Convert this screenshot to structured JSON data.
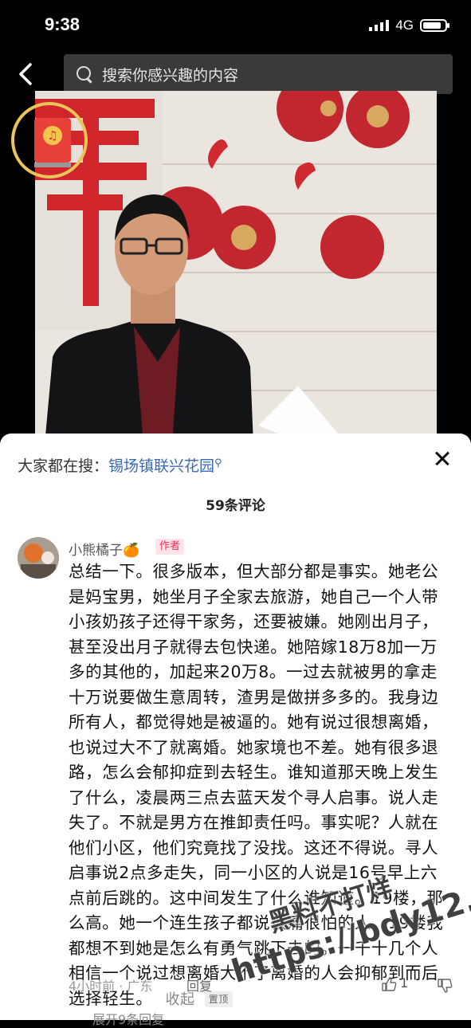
{
  "status_bar": {
    "time": "9:38",
    "network": "4G"
  },
  "search": {
    "placeholder": "搜索你感兴趣的内容"
  },
  "hot_search": {
    "label": "大家都在搜：",
    "term": "锡场镇联兴花园"
  },
  "comments_header": {
    "count_label": "59条评论"
  },
  "comment": {
    "author": "小熊橘子",
    "author_emoji": "🍊",
    "badge": "作者",
    "text": "总结一下。很多版本，但大部分都是事实。她老公是妈宝男，她坐月子全家去旅游，她自己一个人带小孩奶孩子还得干家务，还要被嫌。她刚出月子，甚至没出月子就得去包快递。她陪嫁18万8加一万多的其他的，加起来20万8。一过去就被男的拿走十万说要做生意周转，渣男是做拼多多的。我身边所有人，都觉得她是被逼的。她有说过很想离婚，也说过大不了就离婚。她家境也不差。她有很多退路，怎么会郁抑症到去轻生。谁知道那天晚上发生了什么，凌晨两三点去蓝天发个寻人启事。说人走失了。不就是男方在推卸责任吗。事实呢？人就在他们小区，他们究竟找了没找。这还不得说。寻人启事说2点多走失，同一小区的人说是16号早上六点前后跳的。这中间发生了什么谁知道。19楼，那么高。她一个连生孩子都说很痛很怕的人，19楼我都想不到她是怎么有勇气跳下去的。一千十几个人相信一个说过想离婚大不了离婚的人会抑郁到而后选择轻生。",
    "collapse": "收起",
    "pinned": "置顶",
    "time_location": "4小时前 · 广东",
    "reply": "回复",
    "likes": "1",
    "more_replies": "展开9条回复"
  },
  "watermark": {
    "line1": "黑料不打烊",
    "line2": "https://bdy12.co"
  },
  "icons": [
    "back-arrow-icon",
    "search-icon",
    "red-packet-icon",
    "music-note-icon",
    "close-icon",
    "like-icon",
    "dislike-icon"
  ]
}
